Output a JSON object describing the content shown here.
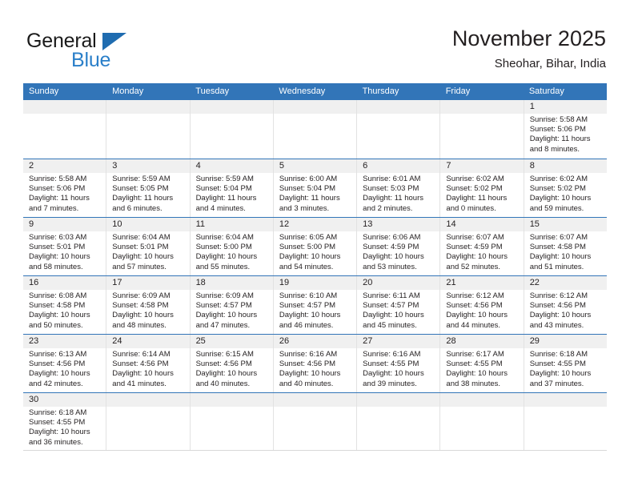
{
  "brand": {
    "name_top": "General",
    "name_bottom": "Blue",
    "triangle_color": "#1f6cb0",
    "blue_text_color": "#2a7fc9"
  },
  "header": {
    "title": "November 2025",
    "subtitle": "Sheohar, Bihar, India"
  },
  "colors": {
    "header_blue": "#3275b8",
    "day_number_band": "#f0f0f0",
    "text": "#231f20",
    "cell_divider": "#e2e2e2"
  },
  "weekdays": [
    "Sunday",
    "Monday",
    "Tuesday",
    "Wednesday",
    "Thursday",
    "Friday",
    "Saturday"
  ],
  "labels": {
    "sunrise_prefix": "Sunrise:",
    "sunset_prefix": "Sunset:",
    "daylight_prefix": "Daylight:"
  },
  "weeks": [
    [
      {
        "day": "",
        "sunrise": "",
        "sunset": "",
        "daylight_line1": "",
        "daylight_line2": ""
      },
      {
        "day": "",
        "sunrise": "",
        "sunset": "",
        "daylight_line1": "",
        "daylight_line2": ""
      },
      {
        "day": "",
        "sunrise": "",
        "sunset": "",
        "daylight_line1": "",
        "daylight_line2": ""
      },
      {
        "day": "",
        "sunrise": "",
        "sunset": "",
        "daylight_line1": "",
        "daylight_line2": ""
      },
      {
        "day": "",
        "sunrise": "",
        "sunset": "",
        "daylight_line1": "",
        "daylight_line2": ""
      },
      {
        "day": "",
        "sunrise": "",
        "sunset": "",
        "daylight_line1": "",
        "daylight_line2": ""
      },
      {
        "day": "1",
        "sunrise": "Sunrise: 5:58 AM",
        "sunset": "Sunset: 5:06 PM",
        "daylight_line1": "Daylight: 11 hours",
        "daylight_line2": "and 8 minutes."
      }
    ],
    [
      {
        "day": "2",
        "sunrise": "Sunrise: 5:58 AM",
        "sunset": "Sunset: 5:06 PM",
        "daylight_line1": "Daylight: 11 hours",
        "daylight_line2": "and 7 minutes."
      },
      {
        "day": "3",
        "sunrise": "Sunrise: 5:59 AM",
        "sunset": "Sunset: 5:05 PM",
        "daylight_line1": "Daylight: 11 hours",
        "daylight_line2": "and 6 minutes."
      },
      {
        "day": "4",
        "sunrise": "Sunrise: 5:59 AM",
        "sunset": "Sunset: 5:04 PM",
        "daylight_line1": "Daylight: 11 hours",
        "daylight_line2": "and 4 minutes."
      },
      {
        "day": "5",
        "sunrise": "Sunrise: 6:00 AM",
        "sunset": "Sunset: 5:04 PM",
        "daylight_line1": "Daylight: 11 hours",
        "daylight_line2": "and 3 minutes."
      },
      {
        "day": "6",
        "sunrise": "Sunrise: 6:01 AM",
        "sunset": "Sunset: 5:03 PM",
        "daylight_line1": "Daylight: 11 hours",
        "daylight_line2": "and 2 minutes."
      },
      {
        "day": "7",
        "sunrise": "Sunrise: 6:02 AM",
        "sunset": "Sunset: 5:02 PM",
        "daylight_line1": "Daylight: 11 hours",
        "daylight_line2": "and 0 minutes."
      },
      {
        "day": "8",
        "sunrise": "Sunrise: 6:02 AM",
        "sunset": "Sunset: 5:02 PM",
        "daylight_line1": "Daylight: 10 hours",
        "daylight_line2": "and 59 minutes."
      }
    ],
    [
      {
        "day": "9",
        "sunrise": "Sunrise: 6:03 AM",
        "sunset": "Sunset: 5:01 PM",
        "daylight_line1": "Daylight: 10 hours",
        "daylight_line2": "and 58 minutes."
      },
      {
        "day": "10",
        "sunrise": "Sunrise: 6:04 AM",
        "sunset": "Sunset: 5:01 PM",
        "daylight_line1": "Daylight: 10 hours",
        "daylight_line2": "and 57 minutes."
      },
      {
        "day": "11",
        "sunrise": "Sunrise: 6:04 AM",
        "sunset": "Sunset: 5:00 PM",
        "daylight_line1": "Daylight: 10 hours",
        "daylight_line2": "and 55 minutes."
      },
      {
        "day": "12",
        "sunrise": "Sunrise: 6:05 AM",
        "sunset": "Sunset: 5:00 PM",
        "daylight_line1": "Daylight: 10 hours",
        "daylight_line2": "and 54 minutes."
      },
      {
        "day": "13",
        "sunrise": "Sunrise: 6:06 AM",
        "sunset": "Sunset: 4:59 PM",
        "daylight_line1": "Daylight: 10 hours",
        "daylight_line2": "and 53 minutes."
      },
      {
        "day": "14",
        "sunrise": "Sunrise: 6:07 AM",
        "sunset": "Sunset: 4:59 PM",
        "daylight_line1": "Daylight: 10 hours",
        "daylight_line2": "and 52 minutes."
      },
      {
        "day": "15",
        "sunrise": "Sunrise: 6:07 AM",
        "sunset": "Sunset: 4:58 PM",
        "daylight_line1": "Daylight: 10 hours",
        "daylight_line2": "and 51 minutes."
      }
    ],
    [
      {
        "day": "16",
        "sunrise": "Sunrise: 6:08 AM",
        "sunset": "Sunset: 4:58 PM",
        "daylight_line1": "Daylight: 10 hours",
        "daylight_line2": "and 50 minutes."
      },
      {
        "day": "17",
        "sunrise": "Sunrise: 6:09 AM",
        "sunset": "Sunset: 4:58 PM",
        "daylight_line1": "Daylight: 10 hours",
        "daylight_line2": "and 48 minutes."
      },
      {
        "day": "18",
        "sunrise": "Sunrise: 6:09 AM",
        "sunset": "Sunset: 4:57 PM",
        "daylight_line1": "Daylight: 10 hours",
        "daylight_line2": "and 47 minutes."
      },
      {
        "day": "19",
        "sunrise": "Sunrise: 6:10 AM",
        "sunset": "Sunset: 4:57 PM",
        "daylight_line1": "Daylight: 10 hours",
        "daylight_line2": "and 46 minutes."
      },
      {
        "day": "20",
        "sunrise": "Sunrise: 6:11 AM",
        "sunset": "Sunset: 4:57 PM",
        "daylight_line1": "Daylight: 10 hours",
        "daylight_line2": "and 45 minutes."
      },
      {
        "day": "21",
        "sunrise": "Sunrise: 6:12 AM",
        "sunset": "Sunset: 4:56 PM",
        "daylight_line1": "Daylight: 10 hours",
        "daylight_line2": "and 44 minutes."
      },
      {
        "day": "22",
        "sunrise": "Sunrise: 6:12 AM",
        "sunset": "Sunset: 4:56 PM",
        "daylight_line1": "Daylight: 10 hours",
        "daylight_line2": "and 43 minutes."
      }
    ],
    [
      {
        "day": "23",
        "sunrise": "Sunrise: 6:13 AM",
        "sunset": "Sunset: 4:56 PM",
        "daylight_line1": "Daylight: 10 hours",
        "daylight_line2": "and 42 minutes."
      },
      {
        "day": "24",
        "sunrise": "Sunrise: 6:14 AM",
        "sunset": "Sunset: 4:56 PM",
        "daylight_line1": "Daylight: 10 hours",
        "daylight_line2": "and 41 minutes."
      },
      {
        "day": "25",
        "sunrise": "Sunrise: 6:15 AM",
        "sunset": "Sunset: 4:56 PM",
        "daylight_line1": "Daylight: 10 hours",
        "daylight_line2": "and 40 minutes."
      },
      {
        "day": "26",
        "sunrise": "Sunrise: 6:16 AM",
        "sunset": "Sunset: 4:56 PM",
        "daylight_line1": "Daylight: 10 hours",
        "daylight_line2": "and 40 minutes."
      },
      {
        "day": "27",
        "sunrise": "Sunrise: 6:16 AM",
        "sunset": "Sunset: 4:55 PM",
        "daylight_line1": "Daylight: 10 hours",
        "daylight_line2": "and 39 minutes."
      },
      {
        "day": "28",
        "sunrise": "Sunrise: 6:17 AM",
        "sunset": "Sunset: 4:55 PM",
        "daylight_line1": "Daylight: 10 hours",
        "daylight_line2": "and 38 minutes."
      },
      {
        "day": "29",
        "sunrise": "Sunrise: 6:18 AM",
        "sunset": "Sunset: 4:55 PM",
        "daylight_line1": "Daylight: 10 hours",
        "daylight_line2": "and 37 minutes."
      }
    ],
    [
      {
        "day": "30",
        "sunrise": "Sunrise: 6:18 AM",
        "sunset": "Sunset: 4:55 PM",
        "daylight_line1": "Daylight: 10 hours",
        "daylight_line2": "and 36 minutes."
      },
      {
        "day": "",
        "sunrise": "",
        "sunset": "",
        "daylight_line1": "",
        "daylight_line2": ""
      },
      {
        "day": "",
        "sunrise": "",
        "sunset": "",
        "daylight_line1": "",
        "daylight_line2": ""
      },
      {
        "day": "",
        "sunrise": "",
        "sunset": "",
        "daylight_line1": "",
        "daylight_line2": ""
      },
      {
        "day": "",
        "sunrise": "",
        "sunset": "",
        "daylight_line1": "",
        "daylight_line2": ""
      },
      {
        "day": "",
        "sunrise": "",
        "sunset": "",
        "daylight_line1": "",
        "daylight_line2": ""
      },
      {
        "day": "",
        "sunrise": "",
        "sunset": "",
        "daylight_line1": "",
        "daylight_line2": ""
      }
    ]
  ]
}
